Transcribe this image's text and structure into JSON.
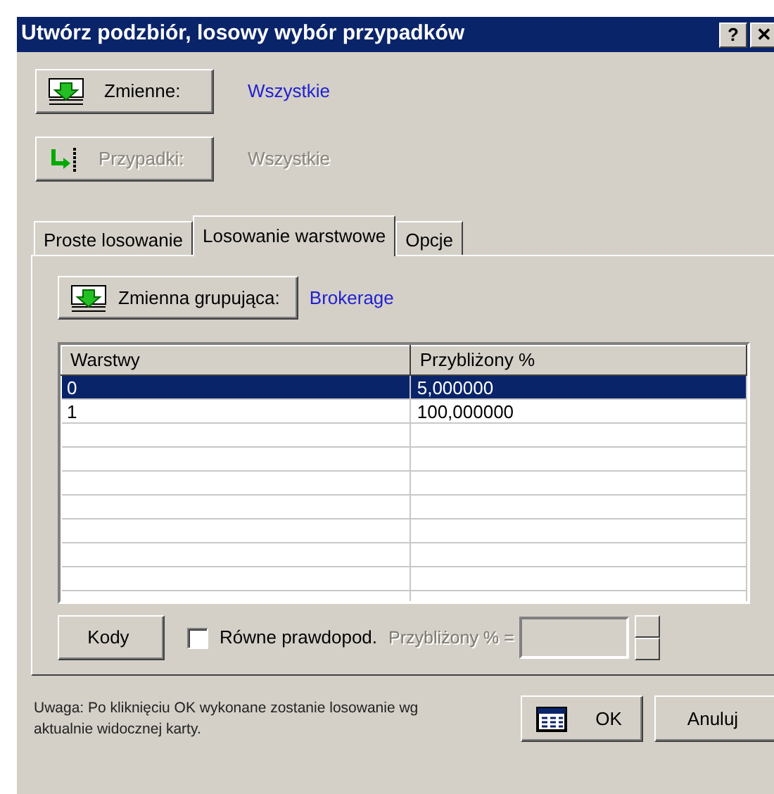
{
  "window": {
    "title": "Utwórz podzbiór, losowy wybór przypadków",
    "title_buttons": [
      "?",
      "✕"
    ]
  },
  "selectors": [
    {
      "label": "Zmienne:",
      "value": "Wszystkie",
      "disabled": false,
      "kind": "variables"
    },
    {
      "label": "Przypadki:",
      "value": "Wszystkie",
      "disabled": true,
      "kind": "cases"
    }
  ],
  "tabs": [
    {
      "label": "Proste losowanie",
      "selected": false
    },
    {
      "label": "Losowanie warstwowe",
      "selected": true
    },
    {
      "label": "Opcje",
      "selected": false
    }
  ],
  "grouping": {
    "label": "Zmienna grupująca:",
    "value": "Brokerage"
  },
  "table": {
    "columns": [
      "Warstwy",
      "Przybliżony %"
    ],
    "rows": [
      {
        "cells": [
          "0",
          "5,000000"
        ],
        "selected": true
      },
      {
        "cells": [
          "1",
          "100,000000"
        ],
        "selected": false
      }
    ]
  },
  "codes_button": "Kody",
  "equal_prob": {
    "label": "Równe prawdopod.",
    "checked": false
  },
  "approx_field": {
    "label": "Przybliżony % =",
    "disabled": true
  },
  "note": "Uwaga: Po kliknięciu OK wykonane zostanie losowanie wg aktualnie widocznej karty.",
  "buttons": [
    "OK",
    "Anuluj"
  ]
}
